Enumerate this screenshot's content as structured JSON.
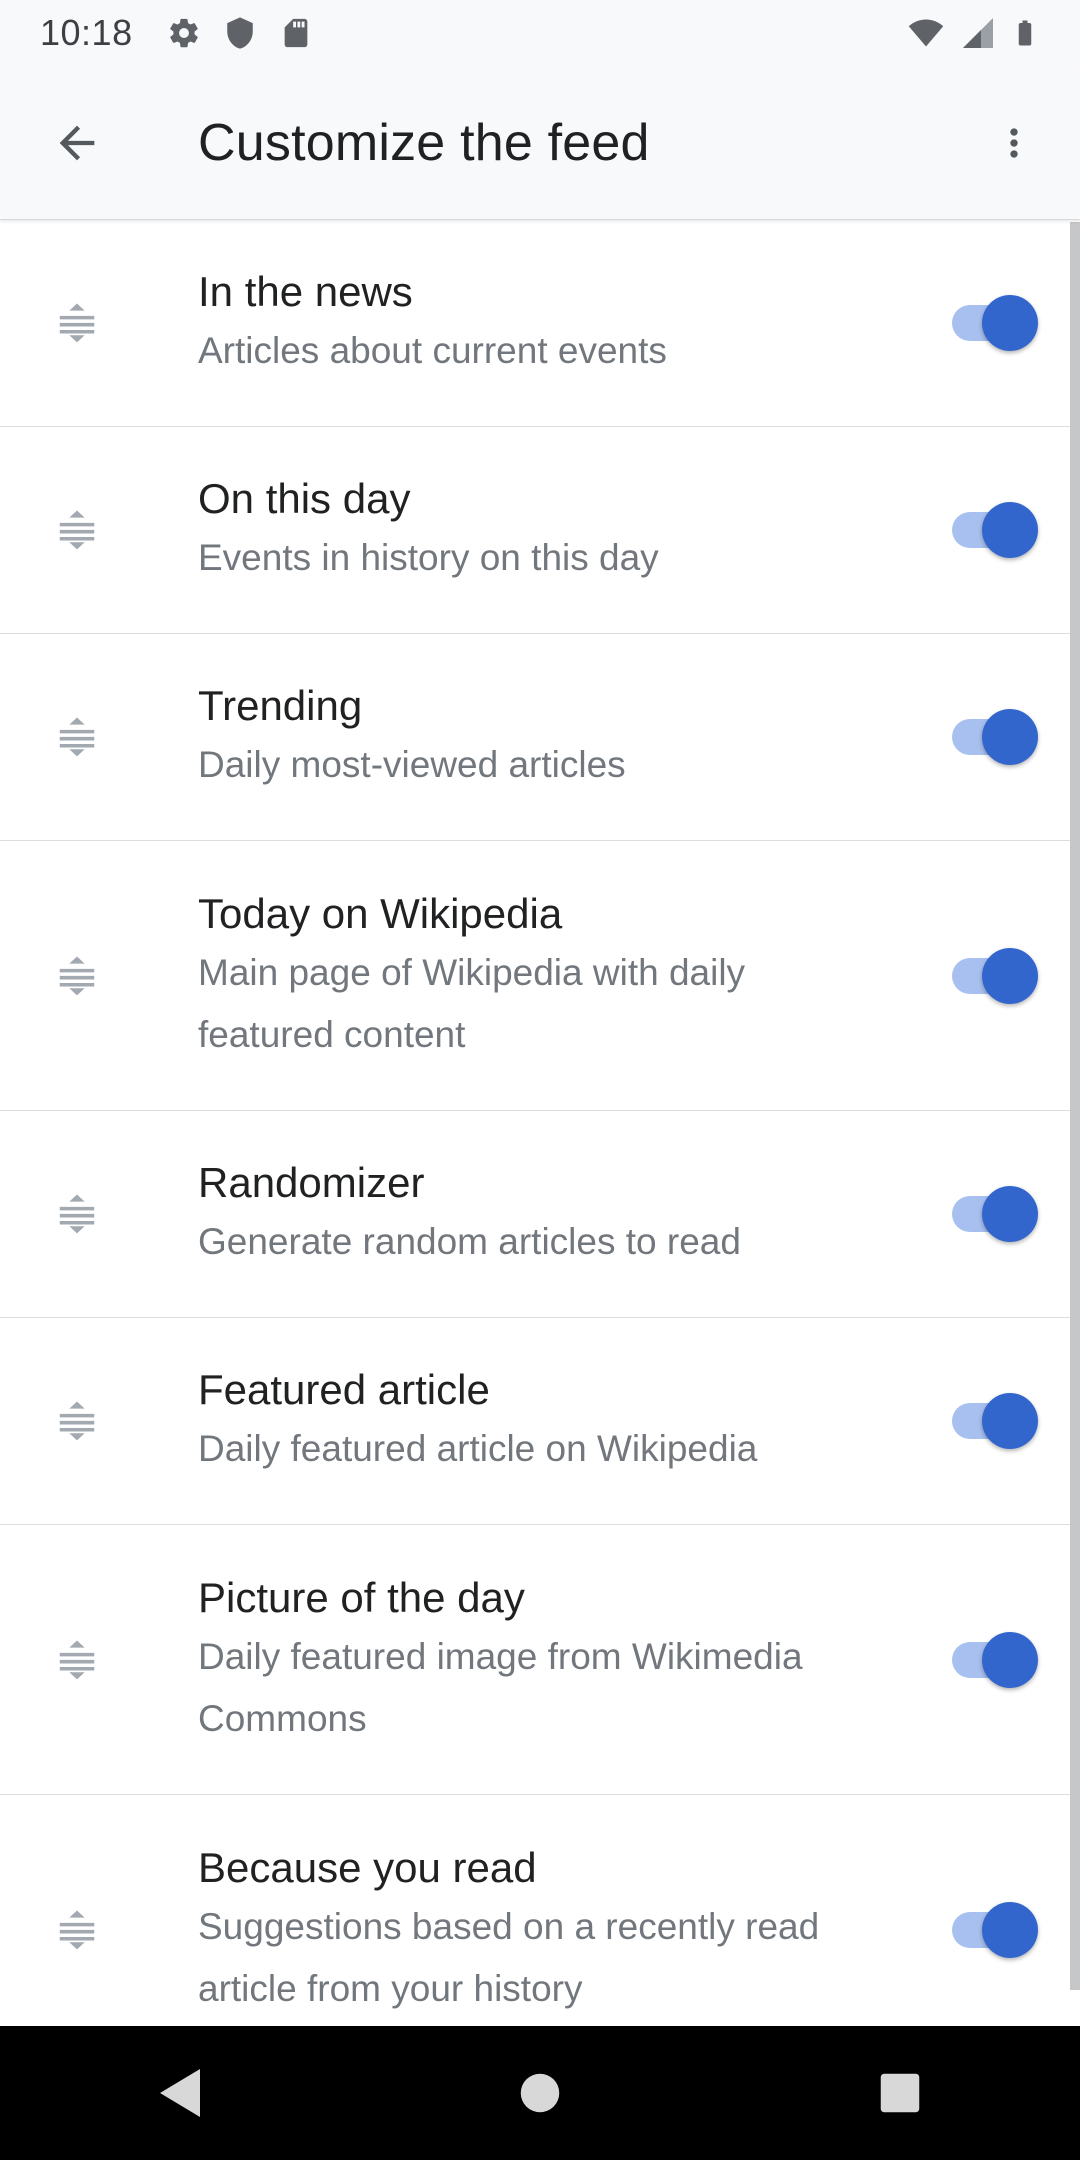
{
  "status_bar": {
    "time": "10:18",
    "icons_left": [
      "gear-icon",
      "shield-icon",
      "sd-card-icon"
    ],
    "icons_right": [
      "wifi-icon",
      "signal-icon",
      "battery-icon"
    ]
  },
  "app_bar": {
    "title": "Customize the feed",
    "back_icon": "arrow-back-icon",
    "menu_icon": "more-vert-icon"
  },
  "items": [
    {
      "title": "In the news",
      "subtitle": "Articles about current events",
      "enabled": true
    },
    {
      "title": "On this day",
      "subtitle": "Events in history on this day",
      "enabled": true
    },
    {
      "title": "Trending",
      "subtitle": "Daily most-viewed articles",
      "enabled": true
    },
    {
      "title": "Today on Wikipedia",
      "subtitle": "Main page of Wikipedia with daily featured content",
      "enabled": true
    },
    {
      "title": "Randomizer",
      "subtitle": "Generate random articles to read",
      "enabled": true
    },
    {
      "title": "Featured article",
      "subtitle": "Daily featured article on Wikipedia",
      "enabled": true
    },
    {
      "title": "Picture of the day",
      "subtitle": "Daily featured image from Wikimedia Commons",
      "enabled": true
    },
    {
      "title": "Because you read",
      "subtitle": "Suggestions based on a recently read article from your history",
      "enabled": true
    }
  ],
  "colors": {
    "accent": "#3366cc",
    "switch_track": "#a8c0ef",
    "title_text": "#202122",
    "subtitle_text": "#72777d"
  },
  "nav_bar": {
    "buttons": [
      "back-triangle-icon",
      "home-circle-icon",
      "recents-square-icon"
    ]
  }
}
